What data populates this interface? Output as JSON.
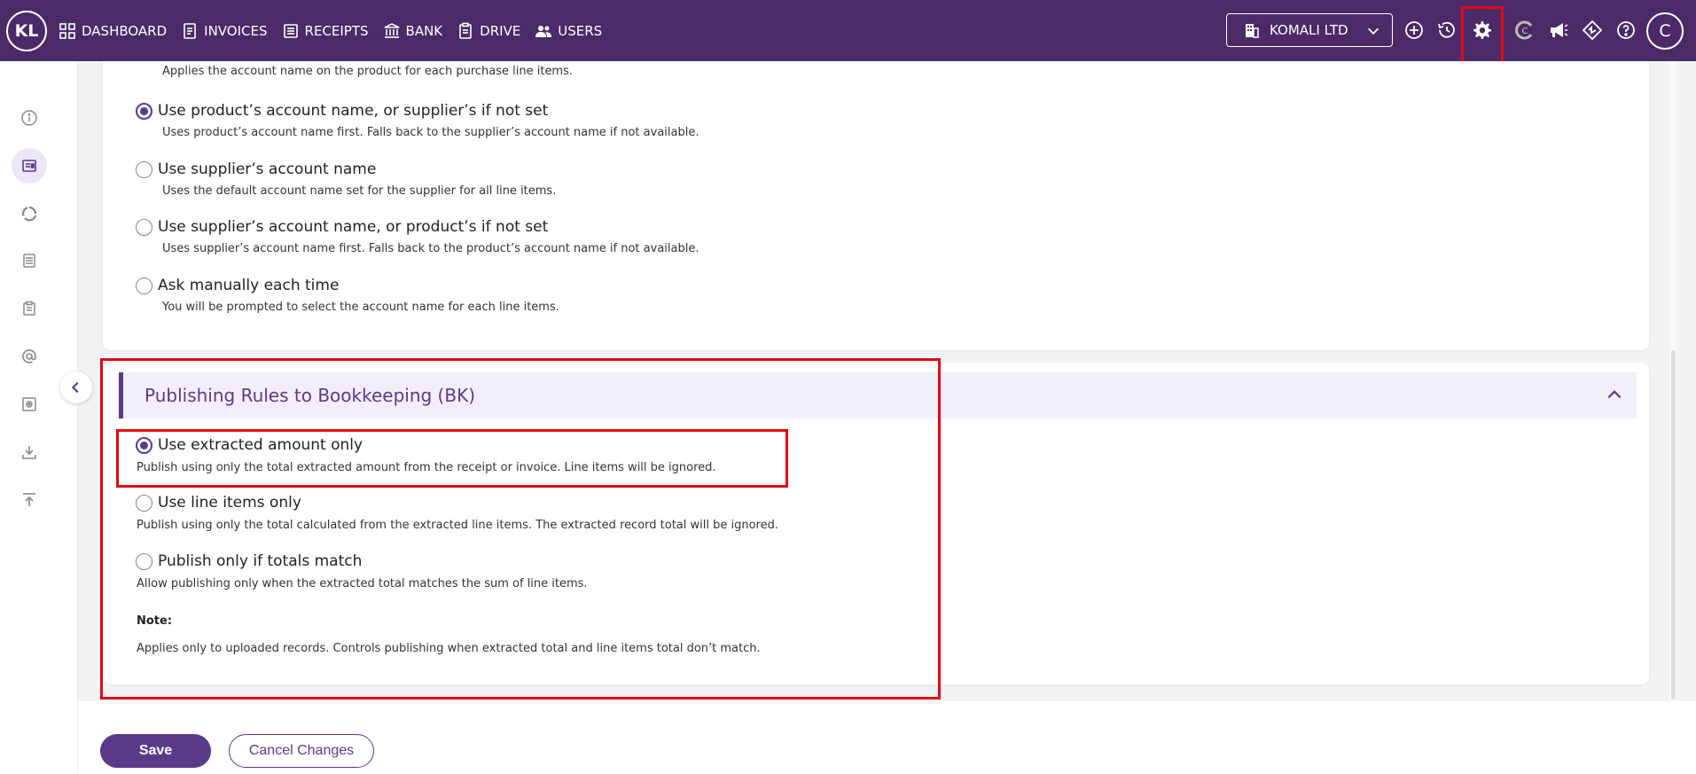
{
  "topbar": {
    "logo": "KL",
    "nav": [
      {
        "label": "DASHBOARD",
        "icon": "dashboard-grid-icon"
      },
      {
        "label": "INVOICES",
        "icon": "invoice-icon"
      },
      {
        "label": "RECEIPTS",
        "icon": "receipt-icon"
      },
      {
        "label": "BANK",
        "icon": "bank-icon"
      },
      {
        "label": "DRIVE",
        "icon": "clipboard-icon"
      },
      {
        "label": "USERS",
        "icon": "users-icon"
      }
    ],
    "company": "KOMALI LTD",
    "avatar": "C"
  },
  "top_accounts": {
    "truncated_desc": "Applies the account name on the product for each purchase line items.",
    "options": [
      {
        "label": "Use product’s account name, or supplier’s if not set",
        "desc": "Uses product’s account name first. Falls back to the supplier’s account name if not available.",
        "checked": true
      },
      {
        "label": "Use supplier’s account name",
        "desc": "Uses the default account name set for the supplier for all line items.",
        "checked": false
      },
      {
        "label": "Use supplier’s account name, or product’s if not set",
        "desc": "Uses supplier’s account name first. Falls back to the product’s account name if not available.",
        "checked": false
      },
      {
        "label": "Ask manually each time",
        "desc": "You will be prompted to select the account name for each line items.",
        "checked": false
      }
    ]
  },
  "publishing": {
    "title": "Publishing Rules to Bookkeeping (BK)",
    "options": [
      {
        "label": "Use extracted amount only",
        "desc": "Publish using only the total extracted amount from the receipt or invoice. Line items will be ignored.",
        "checked": true
      },
      {
        "label": "Use line items only",
        "desc": "Publish using only the total calculated from the extracted line items. The extracted record total will be ignored.",
        "checked": false
      },
      {
        "label": "Publish only if totals match",
        "desc": "Allow publishing only when the extracted total matches the sum of line items.",
        "checked": false
      }
    ],
    "note_title": "Note:",
    "note_text": "Applies only to uploaded records. Controls publishing when extracted total and line items total don’t match."
  },
  "footer": {
    "save": "Save",
    "cancel": "Cancel Changes"
  },
  "colors": {
    "brand": "#4b2a67",
    "accent": "#5b3a8a",
    "highlight": "#e30613"
  }
}
